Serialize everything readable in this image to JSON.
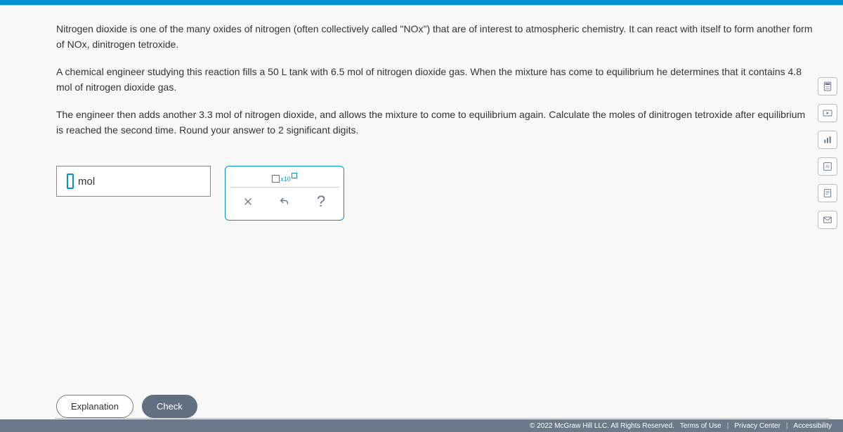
{
  "question": {
    "para1_pre": "Nitrogen dioxide is one of the many oxides of nitrogen (often collectively called \"",
    "nox": "NOx",
    "para1_mid": "\") that are of interest to atmospheric chemistry. It can react with itself to form another form of ",
    "nox2": "NOx",
    "para1_post": ", dinitrogen tetroxide.",
    "para2_pre": "A chemical engineer studying this reaction fills a ",
    "vol": "50 L",
    "para2_mid1": " tank with ",
    "mol1": "6.5 mol",
    "para2_mid2": " of nitrogen dioxide gas. When the mixture has come to equilibrium he determines that it contains ",
    "mol2": "4.8 mol",
    "para2_post": " of nitrogen dioxide gas.",
    "para3_pre": "The engineer then adds another ",
    "mol3": "3.3 mol",
    "para3_mid": " of nitrogen dioxide, and allows the mixture to come to equilibrium again. Calculate the moles of dinitrogen tetroxide after equilibrium is reached the second time. Round your answer to ",
    "sig": "2",
    "para3_post": " significant digits."
  },
  "answer": {
    "unit": "mol",
    "sci_prefix": "x10"
  },
  "buttons": {
    "explanation": "Explanation",
    "check": "Check"
  },
  "footer": {
    "copyright": "© 2022 McGraw Hill LLC. All Rights Reserved.",
    "terms": "Terms of Use",
    "privacy": "Privacy Center",
    "accessibility": "Accessibility"
  }
}
